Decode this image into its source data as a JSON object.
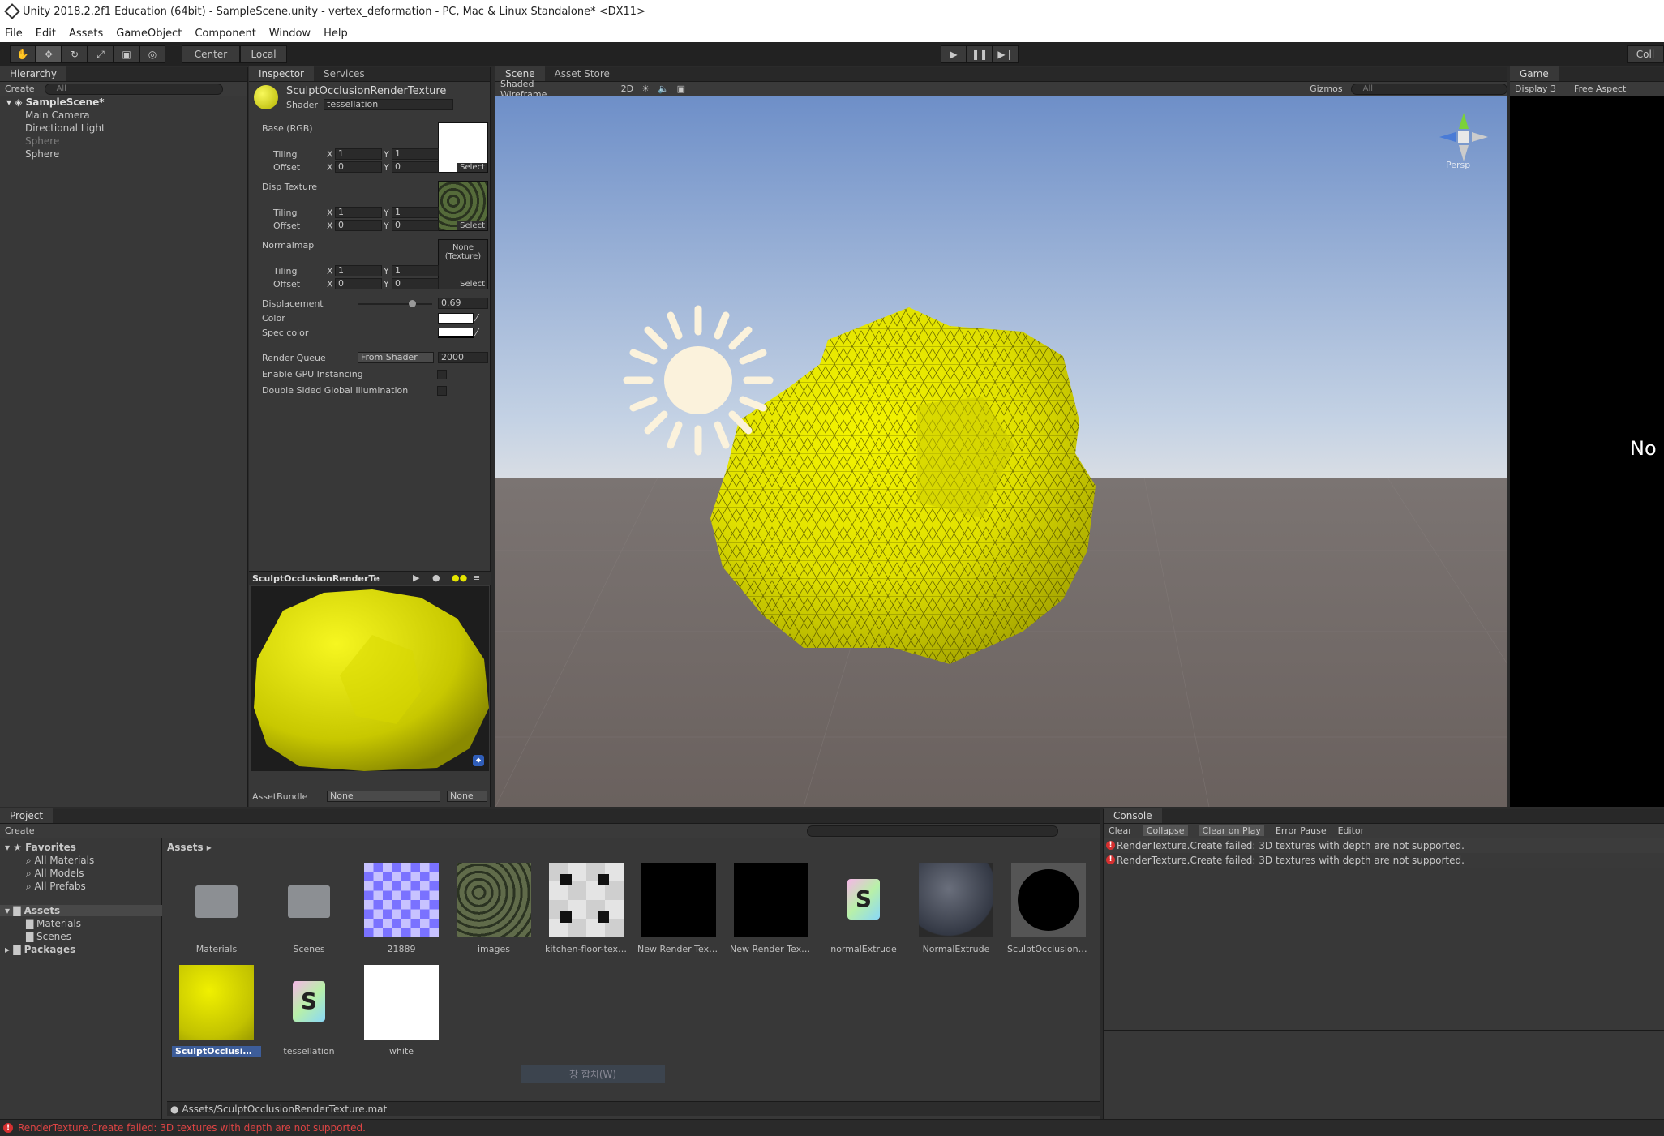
{
  "window": {
    "title": "Unity 2018.2.2f1 Education (64bit) - SampleScene.unity - vertex_deformation - PC, Mac & Linux Standalone* <DX11>"
  },
  "menu": [
    "File",
    "Edit",
    "Assets",
    "GameObject",
    "Component",
    "Window",
    "Help"
  ],
  "toolbar": {
    "center_label": "Center",
    "local_label": "Local",
    "collab_label": "Coll"
  },
  "hierarchy": {
    "tab": "Hierarchy",
    "create": "Create",
    "search": "All",
    "scene": "SampleScene*",
    "items": [
      "Main Camera",
      "Directional Light",
      "Sphere",
      "Sphere"
    ]
  },
  "inspector": {
    "tabs": [
      "Inspector",
      "Services"
    ],
    "material_name": "SculptOcclusionRenderTexture",
    "shader_label": "Shader",
    "shader_value": "tessellation",
    "base_label": "Base (RGB)",
    "disp_label": "Disp Texture",
    "normal_label": "Normalmap",
    "tiling": "Tiling",
    "offset": "Offset",
    "x": "X",
    "y": "Y",
    "tiling_val": "1",
    "offset_val": "0",
    "select": "Select",
    "none_texture": "None (Texture)",
    "displacement_label": "Displacement",
    "displacement_value": "0.69",
    "displacement_fraction": 0.69,
    "color_label": "Color",
    "spec_label": "Spec color",
    "render_queue_label": "Render Queue",
    "render_queue_mode": "From Shader",
    "render_queue_value": "2000",
    "gpu_instancing": "Enable GPU Instancing",
    "double_sided": "Double Sided Global Illumination",
    "preview_title": "SculptOcclusionRenderTe",
    "assetbundle_label": "AssetBundle",
    "assetbundle_none": "None",
    "assetbundle_none2": "None"
  },
  "scene": {
    "tabs": [
      "Scene",
      "Asset Store"
    ],
    "shading": "Shaded Wireframe",
    "mode_2d": "2D",
    "gizmos": "Gizmos",
    "search": "All",
    "persp": "Persp"
  },
  "game": {
    "tab": "Game",
    "display": "Display 3",
    "aspect": "Free Aspect",
    "message": "No"
  },
  "project": {
    "tab": "Project",
    "create": "Create",
    "favorites": "Favorites",
    "fav_items": [
      "All Materials",
      "All Models",
      "All Prefabs"
    ],
    "assets_root": "Assets",
    "asset_folders": [
      "Materials",
      "Scenes"
    ],
    "packages": "Packages",
    "breadcrumb": "Assets",
    "assets": [
      "Materials",
      "Scenes",
      "21889",
      "images",
      "kitchen-floor-text...",
      "New Render Textu...",
      "New Render Textu...",
      "normalExtrude",
      "NormalExtrude",
      "SculptOcclusionR...",
      "SculptOcclusionR...",
      "tessellation",
      "white"
    ],
    "path": "Assets/SculptOcclusionRenderTexture.mat",
    "overlay": "창 합치(W)"
  },
  "console": {
    "tab": "Console",
    "buttons": [
      "Clear",
      "Collapse",
      "Clear on Play",
      "Error Pause",
      "Editor"
    ],
    "messages": [
      "RenderTexture.Create failed: 3D textures with depth are not supported.",
      "RenderTexture.Create failed: 3D textures with depth are not supported."
    ]
  },
  "status": {
    "message": "RenderTexture.Create failed: 3D textures with depth are not supported."
  },
  "colors": {
    "accent": "#4a7bd6",
    "error": "#d63030",
    "sphere": "#e6e600"
  }
}
